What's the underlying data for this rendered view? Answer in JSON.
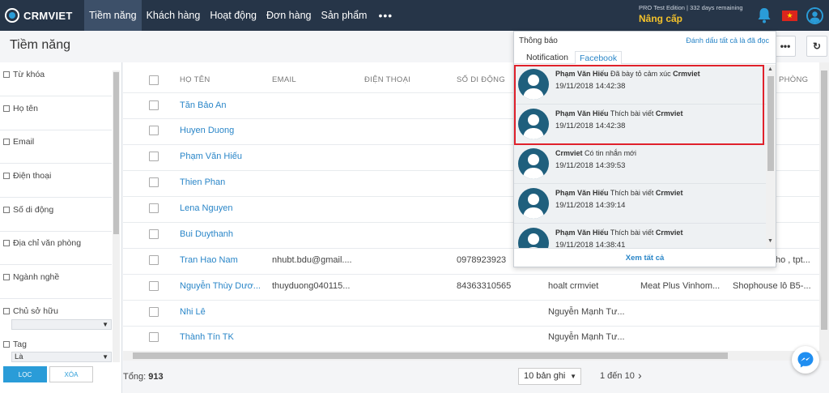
{
  "brand": {
    "name": "CRMVIET"
  },
  "nav": {
    "items": [
      "Tiềm năng",
      "Khách hàng",
      "Hoạt động",
      "Đơn hàng",
      "Sản phẩm"
    ],
    "more": "•••",
    "edition": "PRO Test Edition | 332 days remaining",
    "upgrade": "Nâng cấp"
  },
  "page": {
    "title": "Tiềm năng"
  },
  "toolbar": {
    "more_label": "•••",
    "refresh_icon": "↻"
  },
  "sidebar": {
    "filters": [
      "Từ khóa",
      "Họ tên",
      "Email",
      "Điện thoại",
      "Số di động",
      "Địa chỉ văn phòng",
      "Ngành nghề",
      "Chủ sở hữu",
      "Tag"
    ],
    "owner_select": "",
    "tag_select": "Là",
    "apply_label": "LỌC",
    "clear_label": "XÓA"
  },
  "table": {
    "columns": [
      "HỌ TÊN",
      "EMAIL",
      "ĐIỆN THOẠI",
      "SỐ DI ĐỘNG",
      "PHÒNG"
    ],
    "rows": [
      {
        "name": "Tăn Bảo An",
        "email": "",
        "mobile": "",
        "owner": "",
        "company": "",
        "address": ""
      },
      {
        "name": "Huyen Duong",
        "email": "",
        "mobile": "",
        "owner": "",
        "company": "",
        "address": ""
      },
      {
        "name": "Phạm Văn Hiếu",
        "email": "",
        "mobile": "",
        "owner": "",
        "company": "",
        "address": ""
      },
      {
        "name": "Thien Phan",
        "email": "",
        "mobile": "",
        "owner": "",
        "company": "",
        "address": ""
      },
      {
        "name": "Lena Nguyen",
        "email": "",
        "mobile": "",
        "owner": "",
        "company": "",
        "address": ""
      },
      {
        "name": "Bui Duythanh",
        "email": "",
        "mobile": "",
        "owner": "",
        "company": "",
        "address": ""
      },
      {
        "name": "Tran Hao Nam",
        "email": "nhubt.bdu@gmail....",
        "mobile": "0978923923",
        "owner": "",
        "company": "",
        "address": "ho , tpt..."
      },
      {
        "name": "Nguyễn Thùy Dươ...",
        "email": "thuyduong040115...",
        "mobile": "84363310565",
        "owner": "hoalt crmviet",
        "company": "Meat Plus Vinhom...",
        "address": "Shophouse lô B5-..."
      },
      {
        "name": "Nhi Lê",
        "email": "",
        "mobile": "",
        "owner": "Nguyễn Mạnh Tư...",
        "company": "",
        "address": ""
      },
      {
        "name": "Thành Tín TK",
        "email": "",
        "mobile": "",
        "owner": "Nguyễn Mạnh Tư...",
        "company": "",
        "address": ""
      }
    ]
  },
  "footer": {
    "total_label": "Tổng:",
    "total_value": "913",
    "page_size": "10 bản ghi",
    "range": "1 đến 10",
    "next": "›"
  },
  "notifications": {
    "title": "Thông báo",
    "mark_all": "Đánh dấu tất cả là đã đọc",
    "tabs": [
      "Notification",
      "Facebook"
    ],
    "items": [
      {
        "actor": "Phạm Văn Hiếu",
        "action": "Đã bày tỏ cảm xúc",
        "target": "Crmviet",
        "time": "19/11/2018 14:42:38"
      },
      {
        "actor": "Phạm Văn Hiếu",
        "action": "Thích bài viết",
        "target": "Crmviet",
        "time": "19/11/2018 14:42:38"
      },
      {
        "actor": "Crmviet",
        "action": "Có tin nhắn mới",
        "target": "",
        "time": "19/11/2018 14:39:53"
      },
      {
        "actor": "Phạm Văn Hiếu",
        "action": "Thích bài viết",
        "target": "Crmviet",
        "time": "19/11/2018 14:39:14"
      },
      {
        "actor": "Phạm Văn Hiếu",
        "action": "Thích bài viết",
        "target": "Crmviet",
        "time": "19/11/2018 14:38:41"
      }
    ],
    "view_all": "Xem tất cả"
  },
  "colors": {
    "topbar": "#263548",
    "accent": "#2a9cd8",
    "upgrade": "#f4c22b",
    "highlight": "#e0212b"
  },
  "icons": [
    "logo-icon",
    "bell-icon",
    "vietnam-flag-icon",
    "user-avatar-icon",
    "refresh-icon",
    "messenger-icon",
    "avatar-placeholder-icon"
  ]
}
